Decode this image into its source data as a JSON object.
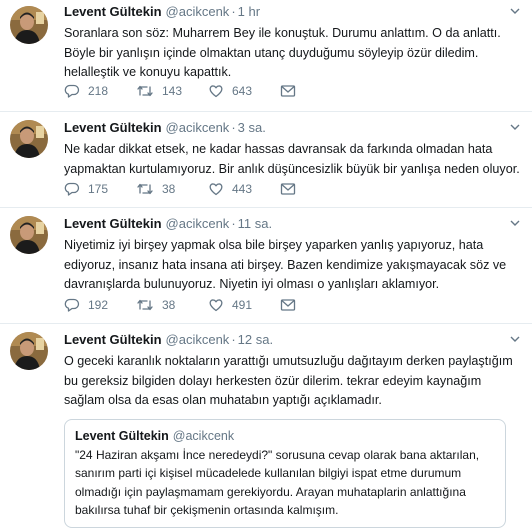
{
  "tweets": [
    {
      "name": "Levent Gültekin",
      "handle": "@acikcenk",
      "dot": "·",
      "time": "1 hr",
      "text": "Soranlara son söz: Muharrem Bey ile konuştuk. Durumu anlattım. O da anlattı.\nBöyle bir yanlışın içinde olmaktan utanç duyduğumu söyleyip özür diledim.\nhelalleştik ve konuyu kapattık.",
      "replies": "218",
      "retweets": "143",
      "likes": "643"
    },
    {
      "name": "Levent Gültekin",
      "handle": "@acikcenk",
      "dot": "·",
      "time": "3 sa.",
      "text": "Ne kadar dikkat etsek, ne kadar hassas davransak da farkında olmadan hata\nyapmaktan kurtulamıyoruz. Bir anlık düşüncesizlik büyük bir yanlışa neden oluyor.",
      "replies": "175",
      "retweets": "38",
      "likes": "443"
    },
    {
      "name": "Levent Gültekin",
      "handle": "@acikcenk",
      "dot": "·",
      "time": "11 sa.",
      "text": "Niyetimiz iyi birşey yapmak olsa bile birşey yaparken yanlış yapıyoruz, hata\nediyoruz, insanız hata insana ati birşey. Bazen kendimize yakışmayacak söz ve\ndavranışlarda bulunuyoruz. Niyetin iyi olması o yanlışları aklamıyor.",
      "replies": "192",
      "retweets": "38",
      "likes": "491"
    },
    {
      "name": "Levent Gültekin",
      "handle": "@acikcenk",
      "dot": "·",
      "time": "12 sa.",
      "text": "O geceki karanlık noktaların yarattığı umutsuzluğu dağıtayım derken paylaştığım\nbu gereksiz bilgiden dolayı herkesten özür dilerim. tekrar edeyim kaynağım\nsağlam olsa da esas olan muhatabın yaptığı açıklamadır."
    }
  ],
  "quote": {
    "name": "Levent Gültekin",
    "handle": "@acikcenk",
    "text": "\"24 Haziran akşamı İnce neredeydi?\" sorusuna cevap olarak bana aktarılan,\nsanırım parti içi kişisel mücadelede kullanılan bilgiyi ispat etme durumum\nolmadığı için paylaşmamam gerekiyordu. Arayan muhataplarin anlattığına\nbakılırsa tuhaf bir çekişmenin ortasında kalmışım."
  },
  "icons": {
    "reply": "reply-icon",
    "retweet": "retweet-icon",
    "like": "heart-icon",
    "dm": "envelope-icon",
    "menu": "chevron-down-icon"
  },
  "colors": {
    "text": "#14171a",
    "secondary": "#657786",
    "divider": "#e6ecf0",
    "quote_border": "#ccd6dd"
  }
}
